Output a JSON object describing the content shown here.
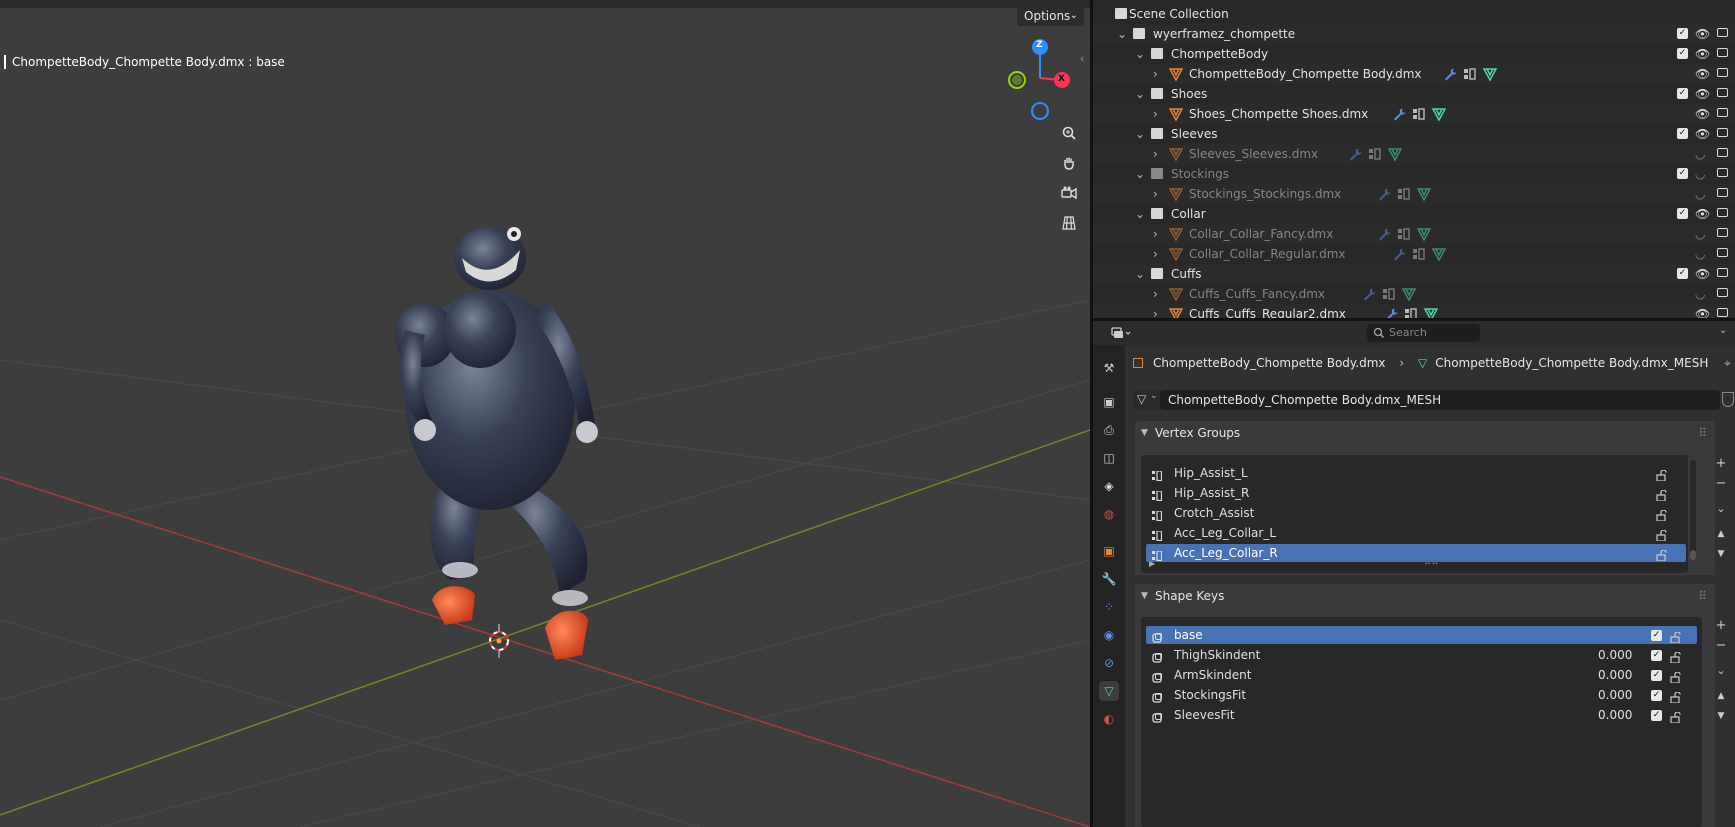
{
  "viewport": {
    "title": "ChompetteBody_Chompette Body.dmx : base",
    "options_label": "Options",
    "gizmo": {
      "x_label": "X",
      "z_label": "Z"
    }
  },
  "outliner": {
    "rows": [
      {
        "label": "Scene Collection",
        "type": "scene",
        "faded": false
      },
      {
        "label": "wyerframez_chompette",
        "type": "collection",
        "faded": false
      },
      {
        "label": "ChompetteBody",
        "type": "collection",
        "faded": false
      },
      {
        "label": "ChompetteBody_Chompette Body.dmx",
        "type": "object",
        "faded": false
      },
      {
        "label": "Shoes",
        "type": "collection",
        "faded": false
      },
      {
        "label": "Shoes_Chompette Shoes.dmx",
        "type": "object",
        "faded": false
      },
      {
        "label": "Sleeves",
        "type": "collection",
        "faded": false
      },
      {
        "label": "Sleeves_Sleeves.dmx",
        "type": "object",
        "faded": true
      },
      {
        "label": "Stockings",
        "type": "collection",
        "faded": true
      },
      {
        "label": "Stockings_Stockings.dmx",
        "type": "object",
        "faded": true
      },
      {
        "label": "Collar",
        "type": "collection",
        "faded": false
      },
      {
        "label": "Collar_Collar_Fancy.dmx",
        "type": "object",
        "faded": true
      },
      {
        "label": "Collar_Collar_Regular.dmx",
        "type": "object",
        "faded": true
      },
      {
        "label": "Cuffs",
        "type": "collection",
        "faded": false
      },
      {
        "label": "Cuffs_Cuffs_Fancy.dmx",
        "type": "object",
        "faded": true
      },
      {
        "label": "Cuffs_Cuffs_Regular2.dmx",
        "type": "object",
        "faded": false
      }
    ]
  },
  "properties": {
    "search_placeholder": "Search",
    "breadcrumb_object": "ChompetteBody_Chompette Body.dmx",
    "breadcrumb_mesh": "ChompetteBody_Chompette Body.dmx_MESH",
    "mesh_name": "ChompetteBody_Chompette Body.dmx_MESH",
    "vertex_groups": {
      "title": "Vertex Groups",
      "items": [
        "Hip_Assist_L",
        "Hip_Assist_R",
        "Crotch_Assist",
        "Acc_Leg_Collar_L",
        "Acc_Leg_Collar_R"
      ],
      "selected": "Acc_Leg_Collar_R"
    },
    "shape_keys": {
      "title": "Shape Keys",
      "items": [
        {
          "name": "base",
          "value": ""
        },
        {
          "name": "ThighSkindent",
          "value": "0.000"
        },
        {
          "name": "ArmSkindent",
          "value": "0.000"
        },
        {
          "name": "StockingsFit",
          "value": "0.000"
        },
        {
          "name": "SleevesFit",
          "value": "0.000"
        }
      ],
      "selected": "base"
    }
  },
  "colors": {
    "selection": "#4772b3",
    "x_axis": "#ff3352",
    "y_axis": "#8bdc00",
    "z_axis": "#2c8fff",
    "object_orange": "#e8843a",
    "mesh_teal": "#4ad8b0"
  }
}
